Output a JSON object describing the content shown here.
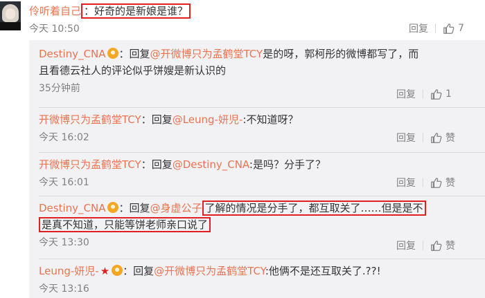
{
  "main_comment": {
    "username": "伶听着自己",
    "separator": "：",
    "text": "好奇的是新娘是谁？",
    "time": "今天 10:50",
    "reply_label": "回复",
    "like_count": "7"
  },
  "replies": [
    {
      "user": "Destiny_CNA",
      "colon": "：",
      "reply_word": "回复",
      "mention": "@开微博只为孟鹤堂TCY",
      "text_line1": "是的呀，郭柯彤的微博都写了，而",
      "text_line2": "且看德云社人的评论似乎饼嫂是新认识的",
      "time": "35分钟前",
      "reply_label": "回复",
      "like_count": "1"
    },
    {
      "user": "开微博只为孟鹤堂TCY",
      "colon": "：",
      "reply_word": "回复",
      "mention": "@Leung-妍児-",
      "text": ":不知道呀？",
      "time": "今天 16:02",
      "reply_label": "回复",
      "like_label": "赞"
    },
    {
      "user": "开微博只为孟鹤堂TCY",
      "colon": "：",
      "reply_word": "回复",
      "mention": "@Destiny_CNA",
      "text": ":是吗？分手了？",
      "time": "今天 16:01",
      "reply_label": "回复",
      "like_label": "赞"
    },
    {
      "user": "Destiny_CNA",
      "colon": "：",
      "reply_word": "回复",
      "mention": "@身虚公子",
      "text_line1": "了解的情况是分手了，都互取关了……但是是不",
      "text_line2": "是真不知道，只能等饼老师亲口说了",
      "time": "今天 13:30",
      "reply_label": "回复",
      "like_label": "赞"
    },
    {
      "user": "Leung-妍児-",
      "star": "★",
      "colon": "：",
      "reply_word": "回复",
      "mention": "@开微博只为孟鹤堂TCY",
      "text": ":他俩不是还互取关了.??!",
      "time": "今天 13:16"
    }
  ]
}
